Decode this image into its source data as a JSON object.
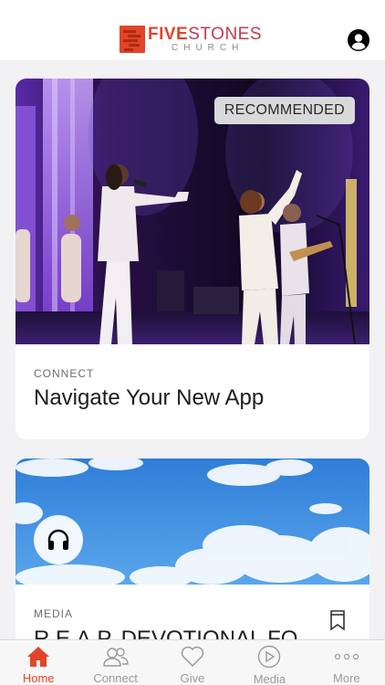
{
  "header": {
    "logo_primary": "FIVE",
    "logo_secondary": "STONES",
    "logo_sub": "CHURCH"
  },
  "cards": [
    {
      "badge": "RECOMMENDED",
      "category": "CONNECT",
      "title": "Navigate Your New App"
    },
    {
      "category": "MEDIA",
      "title": "R.E.A.P. DEVOTIONAL FO"
    }
  ],
  "tabs": [
    {
      "label": "Home",
      "icon": "home-icon",
      "active": true
    },
    {
      "label": "Connect",
      "icon": "people-icon",
      "active": false
    },
    {
      "label": "Give",
      "icon": "heart-icon",
      "active": false
    },
    {
      "label": "Media",
      "icon": "play-icon",
      "active": false
    },
    {
      "label": "More",
      "icon": "more-icon",
      "active": false
    }
  ],
  "colors": {
    "accent": "#e0452a",
    "inactive": "#9a9a9a"
  }
}
